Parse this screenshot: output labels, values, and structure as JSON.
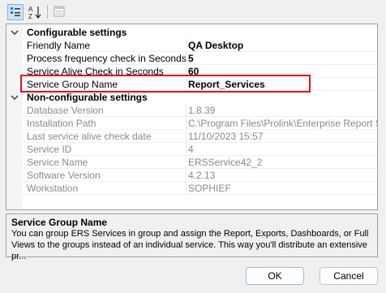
{
  "toolbar": {
    "icons": [
      "categorized-view-icon",
      "alphabetical-sort-icon",
      "property-pages-icon"
    ],
    "alpha_label": "AZ"
  },
  "categories": [
    {
      "title": "Configurable settings",
      "props": [
        {
          "name": "Friendly Name",
          "value": "QA Desktop"
        },
        {
          "name": "Process frequency check in Seconds",
          "value": "5"
        },
        {
          "name": "Service Alive Check in Seconds",
          "value": "60"
        },
        {
          "name": "Service Group Name",
          "value": "Report_Services"
        }
      ]
    },
    {
      "title": "Non-configurable settings",
      "props": [
        {
          "name": "Database Version",
          "value": "1.8.39"
        },
        {
          "name": "Installation Path",
          "value": "C:\\Program Files\\Prolink\\Enterprise Report Sched"
        },
        {
          "name": "Last service alive check date",
          "value": "11/10/2023 15:57"
        },
        {
          "name": "Service ID",
          "value": "4"
        },
        {
          "name": "Service Name",
          "value": "ERSService42_2"
        },
        {
          "name": "Software Version",
          "value": "4.2.13"
        },
        {
          "name": "Workstation",
          "value": "SOPHIEF"
        }
      ]
    }
  ],
  "description": {
    "title": "Service Group Name",
    "line1": "You can group ERS Services in group and assign the Report, Exports, Dashboards, or Full",
    "line2": "Views to the groups instead of an individual service. This way you'll distribute an extensive pr..."
  },
  "buttons": {
    "ok": "OK",
    "cancel": "Cancel"
  },
  "colors": {
    "highlight": "#e0131c",
    "active_button": "#cce4f7"
  }
}
